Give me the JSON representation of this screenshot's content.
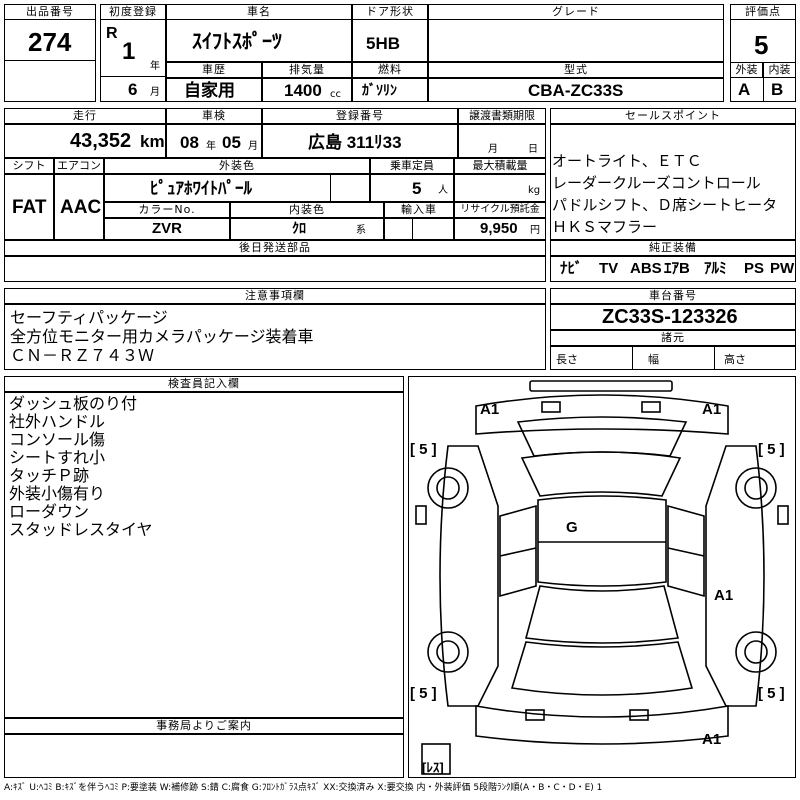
{
  "lot": {
    "label": "出品番号",
    "value": "274"
  },
  "first_reg": {
    "label": "初度登録",
    "era": "R",
    "year": "1",
    "year_unit": "年",
    "month": "6",
    "month_unit": "月"
  },
  "car_name": {
    "label": "車名",
    "value": "ｽｲﾌﾄｽﾎﾟｰﾂ"
  },
  "door": {
    "label": "ドア形状",
    "value": "5HB"
  },
  "grade": {
    "label": "グレード",
    "value": ""
  },
  "score": {
    "label": "評価点",
    "value": "5"
  },
  "history": {
    "label": "車歴",
    "value": "自家用"
  },
  "displacement": {
    "label": "排気量",
    "value": "1400",
    "unit": "cc"
  },
  "fuel": {
    "label": "燃料",
    "value": "ｶﾞｿﾘﾝ"
  },
  "model": {
    "label": "型式",
    "value": "CBA-ZC33S"
  },
  "ext_score": {
    "label": "外装",
    "value": "A"
  },
  "int_score": {
    "label": "内装",
    "value": "B"
  },
  "mileage": {
    "label": "走行",
    "value": "43,352",
    "unit": "km"
  },
  "inspection": {
    "label": "車検",
    "year": "08",
    "year_unit": "年",
    "month": "05",
    "month_unit": "月"
  },
  "plate": {
    "label": "登録番号",
    "value": "広島 311ﾘ33"
  },
  "transfer": {
    "label": "譲渡書類期限",
    "month_unit": "月",
    "day_unit": "日"
  },
  "sales_points": {
    "label": "セールスポイント",
    "items": [
      "オートライト、ＥＴＣ",
      "レーダークルーズコントロール",
      "パドルシフト、Ｄ席シートヒータ",
      "ＨＫＳマフラー"
    ]
  },
  "shift": {
    "label": "シフト",
    "value": "FAT"
  },
  "aircon": {
    "label": "エアコン",
    "value": "AAC"
  },
  "ext_color": {
    "label": "外装色",
    "value": "ﾋﾟｭｱﾎﾜｲﾄﾊﾟｰﾙ"
  },
  "capacity": {
    "label": "乗車定員",
    "value": "5",
    "unit": "人"
  },
  "max_load": {
    "label": "最大積載量",
    "unit": "kg"
  },
  "color_no": {
    "label": "カラーNo.",
    "value": "ZVR"
  },
  "int_color": {
    "label": "内装色",
    "value": "ｸﾛ",
    "suffix": "系"
  },
  "import": {
    "label": "輸入車"
  },
  "recycle": {
    "label": "リサイクル預託金",
    "value": "9,950",
    "unit": "円"
  },
  "later_parts": {
    "label": "後日発送部品"
  },
  "equipment": {
    "label": "純正装備",
    "items": [
      "ﾅﾋﾞ",
      "TV",
      "ABS",
      "ｴｱB",
      "ｱﾙﾐ",
      "PS",
      "PW"
    ]
  },
  "notes": {
    "label": "注意事項欄",
    "lines": [
      "セーフティパッケージ",
      "全方位モニター用カメラパッケージ装着車",
      "ＣＮ－ＲＺ７４３Ｗ"
    ]
  },
  "chassis": {
    "label": "車台番号",
    "value": "ZC33S-123326"
  },
  "specs": {
    "label": "諸元",
    "length": "長さ",
    "width": "幅",
    "height": "高さ"
  },
  "inspector": {
    "label": "検査員記入欄",
    "lines": [
      "ダッシュ板のり付",
      "社外ハンドル",
      "コンソール傷",
      "シートすれ小",
      "タッチＰ跡",
      "外装小傷有り",
      "ローダウン",
      "スタッドレスタイヤ"
    ]
  },
  "office": {
    "label": "事務局よりご案内"
  },
  "diagram": {
    "marks": {
      "fl": "A1",
      "fr": "A1",
      "tire_fl": "[ 5 ]",
      "tire_fr": "[ 5 ]",
      "roof": "G",
      "rear_right": "A1",
      "tire_rl": "[ 5 ]",
      "tire_rr": "[ 5 ]",
      "rear_bumper": "A1",
      "spare": "[ﾚｽ]"
    }
  },
  "legend": "A:ｷｽﾞ U:ﾍｺﾐ B:ｷｽﾞを伴うﾍｺﾐ P:要塗装 W:補修跡 S:錆 C:腐食 G:ﾌﾛﾝﾄｶﾞﾗｽ点ｷｽﾞ XX:交換済み X:要交換  内・外装評価 5段階ﾗﾝｸ順(A・B・C・D・E) 1"
}
